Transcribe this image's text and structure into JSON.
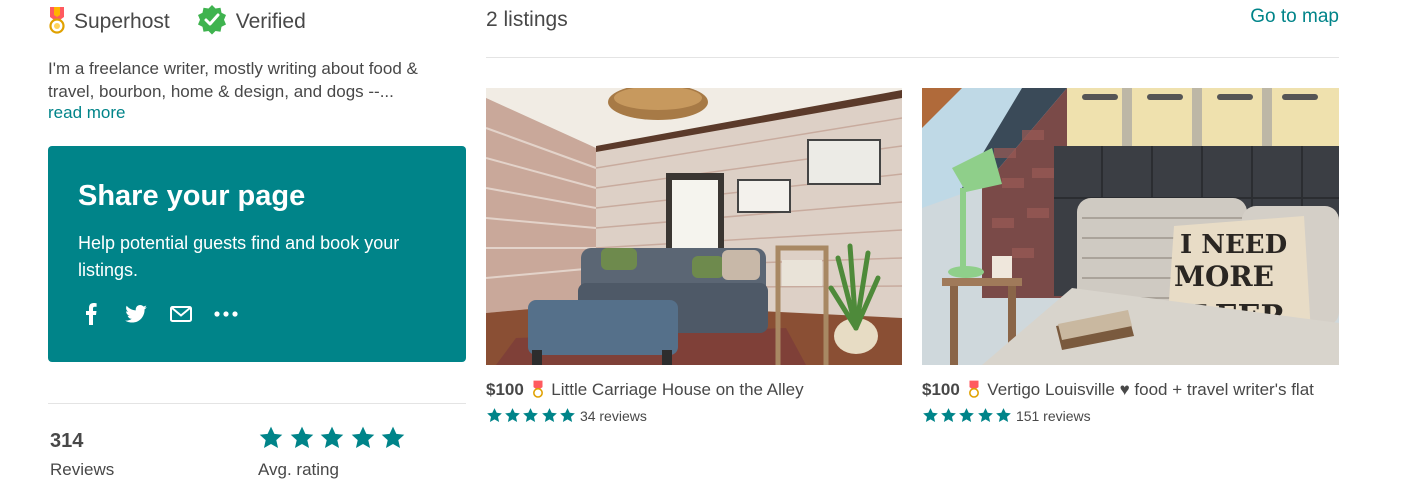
{
  "host": {
    "badges": [
      {
        "label": "Superhost",
        "icon": "superhost-medal-icon"
      },
      {
        "label": "Verified",
        "icon": "verified-check-icon"
      }
    ],
    "bio": "I'm a freelance writer, mostly writing about food & travel, bourbon, home & design, and dogs --...",
    "read_more": "read more"
  },
  "share": {
    "title": "Share your page",
    "subtitle": "Help potential guests find and book your listings.",
    "icons": [
      "facebook-icon",
      "twitter-icon",
      "email-icon",
      "more-icon"
    ]
  },
  "stats": {
    "reviews_count": "314",
    "reviews_label": "Reviews",
    "avg_rating_stars": 5,
    "avg_rating_label": "Avg. rating"
  },
  "listings": {
    "count_label": "2 listings",
    "go_to_map": "Go to map",
    "items": [
      {
        "price": "$100",
        "title": "Little Carriage House on the Alley",
        "stars": 5,
        "reviews": "34 reviews"
      },
      {
        "price": "$100",
        "title": "Vertigo Louisville ♥ food + travel writer's flat",
        "stars": 5,
        "reviews": "151 reviews"
      }
    ]
  },
  "colors": {
    "accent": "#008489",
    "text": "#484848",
    "star": "#008489",
    "verified": "#3fb34f",
    "medal": "#ff5a5f"
  }
}
